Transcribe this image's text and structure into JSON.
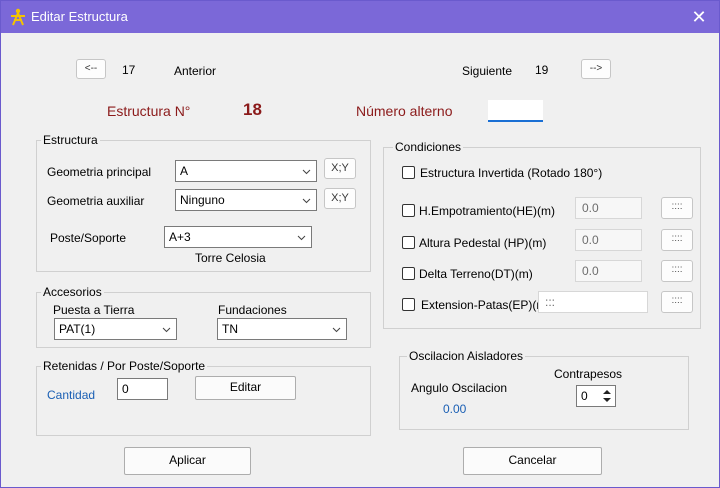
{
  "window": {
    "title": "Editar Estructura",
    "close_symbol": "✕"
  },
  "nav": {
    "prev_button": "<--",
    "prev_number": "17",
    "prev_label": "Anterior",
    "next_label": "Siguiente",
    "next_number": "19",
    "next_button": "-->"
  },
  "header": {
    "estructura_label": "Estructura N°",
    "estructura_number": "18",
    "numero_alterno_label": "Número alterno",
    "numero_alterno_value": ""
  },
  "estructura": {
    "group_title": "Estructura",
    "geometria_principal_label": "Geometria principal",
    "geometria_principal_value": "A",
    "geometria_auxiliar_label": "Geometria auxiliar",
    "geometria_auxiliar_value": "Ninguno",
    "xy_button": "X;Y",
    "poste_label": "Poste/Soporte",
    "poste_value": "A+3",
    "poste_desc": "Torre Celosia"
  },
  "accesorios": {
    "group_title": "Accesorios",
    "puesta_label": "Puesta a Tierra",
    "puesta_value": "PAT(1)",
    "fundaciones_label": "Fundaciones",
    "fundaciones_value": "TN"
  },
  "retenidas": {
    "group_title": "Retenidas / Por Poste/Soporte",
    "cantidad_label": "Cantidad",
    "cantidad_value": "0",
    "editar_button": "Editar"
  },
  "condiciones": {
    "group_title": "Condiciones",
    "invertida_label": "Estructura Invertida (Rotado 180°)",
    "he_label": "H.Empotramiento(HE)(m)",
    "he_value": "0.0",
    "hp_label": "Altura Pedestal (HP)(m)",
    "hp_value": "0.0",
    "dt_label": "Delta Terreno(DT)(m)",
    "dt_value": "0.0",
    "ep_label": "Extension-Patas(EP)(m",
    "ep_value": ":::",
    "dots_button": "::::"
  },
  "oscilacion": {
    "group_title": "Oscilacion Aisladores",
    "angulo_label": "Angulo Oscilacion",
    "angulo_value": "0.00",
    "contrapesos_label": "Contrapesos",
    "contrapesos_value": "0"
  },
  "footer": {
    "aplicar_button": "Aplicar",
    "cancelar_button": "Cancelar"
  },
  "colors": {
    "titlebar": "#7b68d8",
    "accent_maroon": "#8b1a1a",
    "accent_blue": "#1a5fb4"
  }
}
